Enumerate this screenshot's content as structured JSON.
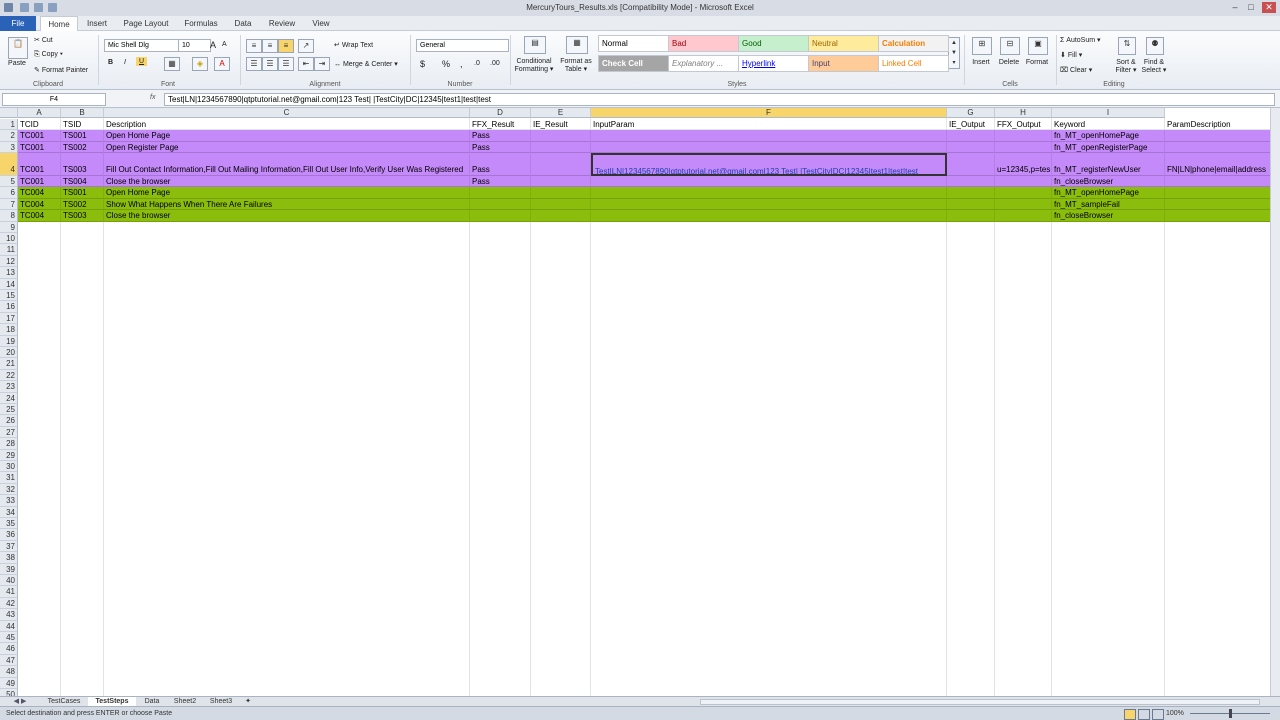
{
  "window": {
    "title": "MercuryTours_Results.xls  [Compatibility Mode]  -  Microsoft Excel",
    "min": "–",
    "max": "□",
    "close": "✕"
  },
  "tabs": [
    "File",
    "Home",
    "Insert",
    "Page Layout",
    "Formulas",
    "Data",
    "Review",
    "View"
  ],
  "ribbon": {
    "clipboard": {
      "paste": "Paste",
      "cut": "Cut",
      "copy": "Copy ▾",
      "format_painter": "Format Painter",
      "label": "Clipboard"
    },
    "font": {
      "name": "Mic Shell Dlg",
      "size": "10",
      "grow": "A",
      "shrink": "A",
      "bold": "B",
      "italic": "I",
      "underline": "U",
      "label": "Font"
    },
    "alignment": {
      "wrap": "Wrap Text",
      "merge": "Merge & Center ▾",
      "label": "Alignment"
    },
    "number": {
      "format": "General",
      "currency": "$",
      "percent": "%",
      "comma": ",",
      "inc": ".0",
      "dec": ".00",
      "label": "Number"
    },
    "styles": {
      "conditional": "Conditional Formatting ▾",
      "format_table": "Format as Table ▾",
      "cells": [
        {
          "label": "Normal",
          "bg": "#ffffff",
          "fg": "#000000"
        },
        {
          "label": "Bad",
          "bg": "#ffc7ce",
          "fg": "#9c0006"
        },
        {
          "label": "Good",
          "bg": "#c6efce",
          "fg": "#006100"
        },
        {
          "label": "Neutral",
          "bg": "#ffeb9c",
          "fg": "#9c6500"
        },
        {
          "label": "Calculation",
          "bg": "#f2f2f2",
          "fg": "#fa7d00"
        },
        {
          "label": "Check Cell",
          "bg": "#a5a5a5",
          "fg": "#ffffff"
        },
        {
          "label": "Explanatory ...",
          "bg": "#ffffff",
          "fg": "#7f7f7f"
        },
        {
          "label": "Hyperlink",
          "bg": "#ffffff",
          "fg": "#0000ff"
        },
        {
          "label": "Input",
          "bg": "#ffcc99",
          "fg": "#3f3f76"
        },
        {
          "label": "Linked Cell",
          "bg": "#ffffff",
          "fg": "#fa7d00"
        }
      ],
      "label": "Styles"
    },
    "cells": {
      "insert": "Insert",
      "delete": "Delete",
      "format": "Format",
      "label": "Cells"
    },
    "editing": {
      "autosum": "AutoSum ▾",
      "fill": "Fill ▾",
      "clear": "Clear ▾",
      "sort": "Sort & Filter ▾",
      "find": "Find & Select ▾",
      "label": "Editing"
    }
  },
  "formula_bar": {
    "name_box": "F4",
    "fx": "fx",
    "content": "Test|LN|1234567890|qtptutorial.net@gmail.com|123 Test| |TestCity|DC|12345|test1|test|test"
  },
  "grid": {
    "columns": [
      "A",
      "B",
      "C",
      "D",
      "E",
      "F",
      "G",
      "H",
      "I"
    ],
    "selected_column": "F",
    "selected_row": "4",
    "colors": {
      "purple": "#c58af9",
      "green": "#8bbd0c"
    },
    "rows": [
      {
        "n": "1",
        "color": "",
        "cells": [
          "TCID",
          "TSID",
          "Description",
          "FFX_Result",
          "IE_Result",
          "InputParam",
          "IE_Output",
          "FFX_Output",
          "Keyword",
          "ParamDescription"
        ]
      },
      {
        "n": "2",
        "color": "purple",
        "cells": [
          "TC001",
          "TS001",
          "Open Home Page",
          "Pass",
          "",
          "",
          "",
          "",
          "fn_MT_openHomePage",
          ""
        ]
      },
      {
        "n": "3",
        "color": "purple",
        "cells": [
          "TC001",
          "TS002",
          "Open Register Page",
          "Pass",
          "",
          "",
          "",
          "",
          "fn_MT_openRegisterPage",
          ""
        ]
      },
      {
        "n": "4",
        "color": "purple",
        "cells": [
          "TC001",
          "TS003",
          "Fill Out Contact Information,Fill Out Mailing Information,Fill Out User Info,Verify User Was Registered",
          "Pass",
          "",
          "Test|LN|1234567890|qtptutorial.net@gmail.com|123 Test| |TestCity|DC|12345|test1|test|test",
          "",
          "u=12345,p=tes",
          "fn_MT_registerNewUser",
          "FN|LN|phone|email|address"
        ]
      },
      {
        "n": "5",
        "color": "purple",
        "cells": [
          "TC001",
          "TS004",
          "Close the browser",
          "Pass",
          "",
          "",
          "",
          "",
          "fn_closeBrowser",
          ""
        ]
      },
      {
        "n": "6",
        "color": "green",
        "cells": [
          "TC004",
          "TS001",
          "Open Home Page",
          "",
          "",
          "",
          "",
          "",
          "fn_MT_openHomePage",
          ""
        ]
      },
      {
        "n": "7",
        "color": "green",
        "cells": [
          "TC004",
          "TS002",
          "Show What Happens When There Are Failures",
          "",
          "",
          "",
          "",
          "",
          "fn_MT_sampleFail",
          ""
        ]
      },
      {
        "n": "8",
        "color": "green",
        "cells": [
          "TC004",
          "TS003",
          "Close the browser",
          "",
          "",
          "",
          "",
          "",
          "fn_closeBrowser",
          ""
        ]
      }
    ],
    "empty_rows": [
      "9",
      "10",
      "11",
      "12",
      "13",
      "14",
      "15",
      "16",
      "17",
      "18",
      "19",
      "20",
      "21",
      "22",
      "23",
      "24",
      "25",
      "26",
      "27",
      "28",
      "29",
      "30",
      "31",
      "32",
      "33",
      "34",
      "35",
      "36",
      "37",
      "38",
      "39",
      "40",
      "41",
      "42",
      "43",
      "44",
      "45",
      "46",
      "47",
      "48",
      "49",
      "50"
    ]
  },
  "sheets": [
    "TestCases",
    "TestSteps",
    "Data",
    "Sheet2",
    "Sheet3"
  ],
  "active_sheet": "TestSteps",
  "status": {
    "message": "Select destination and press ENTER or choose Paste",
    "zoom": "100%"
  }
}
